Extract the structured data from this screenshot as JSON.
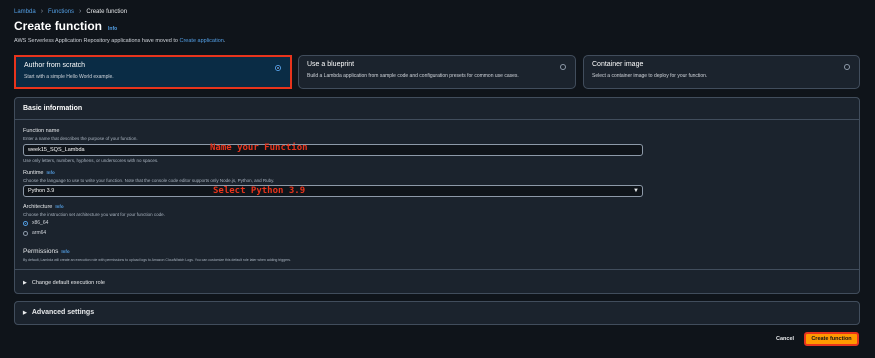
{
  "breadcrumb": {
    "items": [
      "Lambda",
      "Functions"
    ],
    "current": "Create function"
  },
  "header": {
    "title": "Create function",
    "info": "Info"
  },
  "notice": {
    "text": "AWS Serverless Application Repository applications have moved to ",
    "link": "Create application",
    "suffix": "."
  },
  "options": [
    {
      "title": "Author from scratch",
      "description": "Start with a simple Hello World example.",
      "selected": true
    },
    {
      "title": "Use a blueprint",
      "description": "Build a Lambda application from sample code and configuration presets for common use cases.",
      "selected": false
    },
    {
      "title": "Container image",
      "description": "Select a container image to deploy for your function.",
      "selected": false
    }
  ],
  "basic": {
    "heading": "Basic information",
    "function_name": {
      "label": "Function name",
      "description": "Enter a name that describes the purpose of your function.",
      "value": "week15_SQS_Lambda",
      "hint": "Use only letters, numbers, hyphens, or underscores with no spaces."
    },
    "runtime": {
      "label": "Runtime",
      "info": "Info",
      "description": "Choose the language to use to write your function. Note that the console code editor supports only Node.js, Python, and Ruby.",
      "value": "Python 3.9"
    },
    "architecture": {
      "label": "Architecture",
      "info": "Info",
      "description": "Choose the instruction set architecture you want for your function code.",
      "options": [
        "x86_64",
        "arm64"
      ],
      "selected": "x86_64"
    },
    "permissions": {
      "label": "Permissions",
      "info": "Info",
      "description": "By default, Lambda will create an execution role with permissions to upload logs to Amazon CloudWatch Logs. You can customize this default role later when adding triggers."
    },
    "execution_role_label": "Change default execution role"
  },
  "annotations": {
    "name": "Name your Function",
    "runtime": "Select Python 3.9"
  },
  "advanced_label": "Advanced settings",
  "footer": {
    "cancel": "Cancel",
    "create": "Create function"
  }
}
